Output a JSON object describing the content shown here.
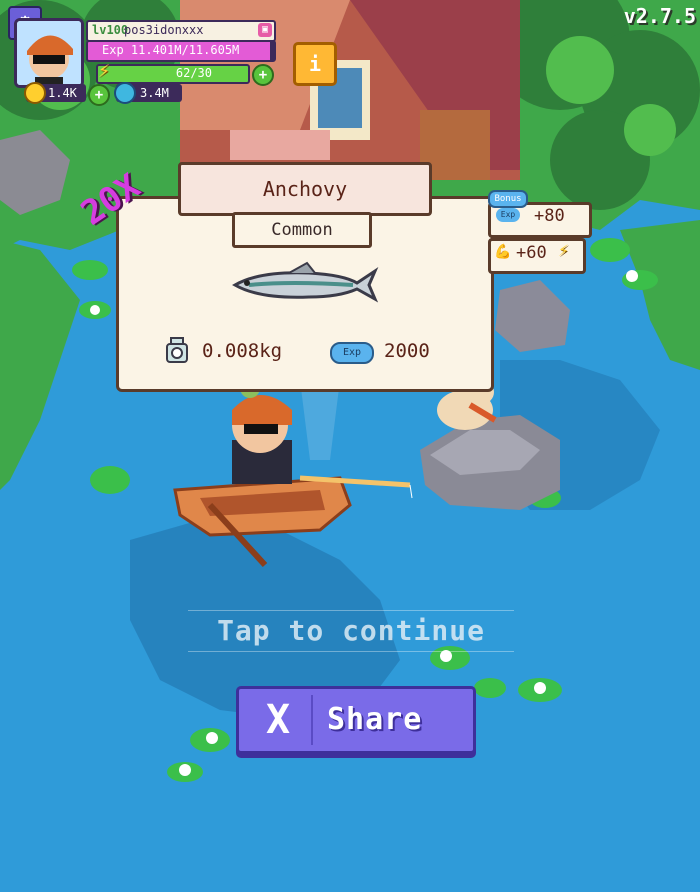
{
  "hud": {
    "level": "lv100",
    "username": "pos3idonxxx",
    "exp_text": "Exp 11.401M/11.605M",
    "exp_progress": 0.98,
    "energy_text": "62/30",
    "energy_progress": 1.0,
    "coins": "1.4K",
    "gems": "3.4M",
    "version": "v2.7.5"
  },
  "catch": {
    "multiplier": "20X",
    "fish_name": "Anchovy",
    "rarity": "Common",
    "weight": "0.008kg",
    "exp_label": "Exp",
    "exp_value": "2000"
  },
  "bonus": {
    "tag": "Bonus",
    "exp_label": "Exp",
    "exp_value": "+80",
    "energy_value": "+60"
  },
  "prompt": {
    "tap_text": "Tap to continue"
  },
  "share": {
    "icon": "X",
    "label": "Share"
  },
  "colors": {
    "water": "#2f9bd9",
    "grass": "#3fa84a",
    "card_bg": "#fbf4e6",
    "card_border": "#5a3b2a",
    "share_button": "#7a6be8",
    "multiplier": "#d63de0"
  }
}
